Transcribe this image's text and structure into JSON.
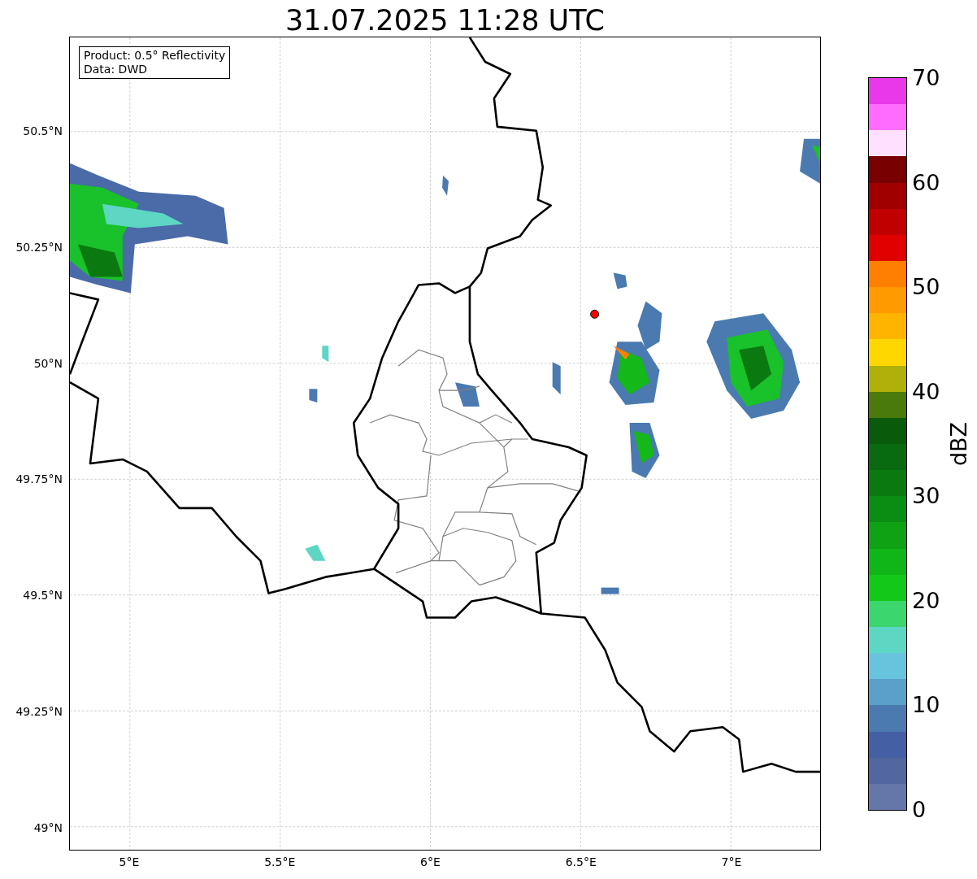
{
  "title": "31.07.2025 11:28 UTC",
  "info_box": {
    "lines": [
      "Product: 0.5° Reflectivity",
      "Data: DWD"
    ]
  },
  "map": {
    "lat_ticks": [
      "50.5°N",
      "50.25°N",
      "50°N",
      "49.75°N",
      "49.5°N",
      "49.25°N",
      "49°N"
    ],
    "lon_ticks": [
      "5°E",
      "5.5°E",
      "6°E",
      "6.5°E",
      "7°E"
    ]
  },
  "colorbar": {
    "label": "dBZ",
    "ticks": [
      "70",
      "60",
      "50",
      "40",
      "30",
      "20",
      "10",
      "0"
    ]
  }
}
